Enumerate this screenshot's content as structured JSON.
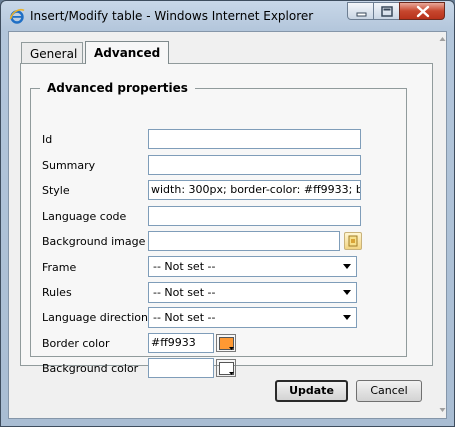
{
  "window": {
    "title": "Insert/Modify table - Windows Internet Explorer",
    "app_icon": "internet-explorer-icon",
    "controls": [
      "minimize-icon",
      "maximize-icon",
      "close-icon"
    ]
  },
  "tabs": [
    {
      "label": "General",
      "active": false
    },
    {
      "label": "Advanced",
      "active": true
    }
  ],
  "section": {
    "legend": "Advanced properties"
  },
  "fields": {
    "id": {
      "label": "Id",
      "value": ""
    },
    "summary": {
      "label": "Summary",
      "value": ""
    },
    "style": {
      "label": "Style",
      "value": "width: 300px; border-color: #ff9933; b"
    },
    "language_code": {
      "label": "Language code",
      "value": ""
    },
    "background_image": {
      "label": "Background image",
      "value": ""
    },
    "frame": {
      "label": "Frame",
      "selected": "-- Not set --"
    },
    "rules": {
      "label": "Rules",
      "selected": "-- Not set --"
    },
    "language_direction": {
      "label": "Language direction",
      "selected": "-- Not set --"
    },
    "border_color": {
      "label": "Border color",
      "value": "#ff9933",
      "swatch": "#ff9933"
    },
    "background_color": {
      "label": "Background color",
      "value": "",
      "swatch": "#ffffff"
    }
  },
  "buttons": {
    "update": "Update",
    "cancel": "Cancel"
  },
  "colors": {
    "accent": "#ff9933",
    "panel": "#f7f7f7",
    "frame": "#b3c6db"
  }
}
